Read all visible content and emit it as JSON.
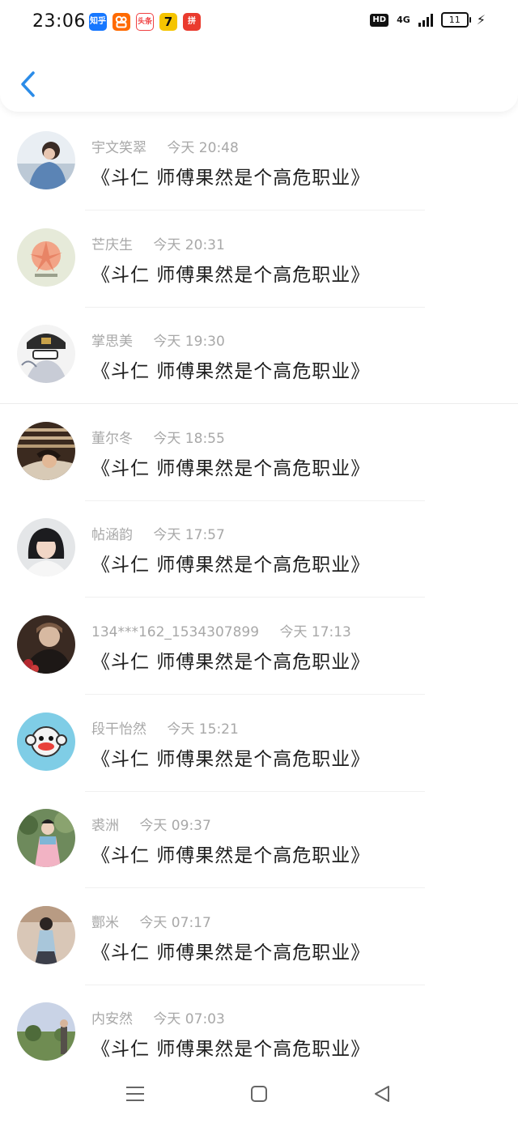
{
  "status_bar": {
    "time": "23:06",
    "apps": [
      {
        "name": "zhihu",
        "label": "知乎",
        "color": "#1677ff"
      },
      {
        "name": "kuaishou",
        "label": "88",
        "color": "#ff6a00"
      },
      {
        "name": "toutiao",
        "label": "头条",
        "color": "#f04142"
      },
      {
        "name": "qimao",
        "label": "7",
        "color": "#f5c400"
      },
      {
        "name": "pinduoduo",
        "label": "拼",
        "color": "#ea3b2e"
      }
    ],
    "hd": "HD",
    "network": "4G",
    "battery": "11"
  },
  "header": {
    "back_icon": "chevron-left-icon",
    "accent": "#2b8ce8"
  },
  "messages": [
    {
      "name": "宇文笑翠",
      "time": "今天 20:48",
      "text": "《斗仁 师傅果然是个高危职业》",
      "avatar": "portrait-denim-girl"
    },
    {
      "name": "芒庆生",
      "time": "今天 20:31",
      "text": "《斗仁 师傅果然是个高危职业》",
      "avatar": "flower-pink"
    },
    {
      "name": "掌思美",
      "time": "今天 19:30",
      "text": "《斗仁 师傅果然是个高危职业》",
      "avatar": "beanie-anime"
    },
    {
      "name": "董尔冬",
      "time": "今天 18:55",
      "text": "《斗仁 师傅果然是个高危职业》",
      "avatar": "sleeping-man"
    },
    {
      "name": "帖涵韵",
      "time": "今天 17:57",
      "text": "《斗仁 师傅果然是个高危职业》",
      "avatar": "girl-bangs"
    },
    {
      "name": "134***162_1534307899",
      "time": "今天 17:13",
      "text": "《斗仁 师傅果然是个高危职业》",
      "avatar": "dark-portrait"
    },
    {
      "name": "段干怡然",
      "time": "今天 15:21",
      "text": "《斗仁 师傅果然是个高危职业》",
      "avatar": "paul-frank-monkey"
    },
    {
      "name": "裘洲",
      "time": "今天 09:37",
      "text": "《斗仁 师傅果然是个高危职业》",
      "avatar": "hanfu-garden"
    },
    {
      "name": "酆米",
      "time": "今天 07:17",
      "text": "《斗仁 师傅果然是个高危职业》",
      "avatar": "school-girl"
    },
    {
      "name": "内安然",
      "time": "今天 07:03",
      "text": "《斗仁 师傅果然是个高危职业》",
      "avatar": "landscape-person"
    }
  ],
  "navbar": {
    "items": [
      "menu-icon",
      "home-square-icon",
      "back-triangle-icon"
    ]
  }
}
